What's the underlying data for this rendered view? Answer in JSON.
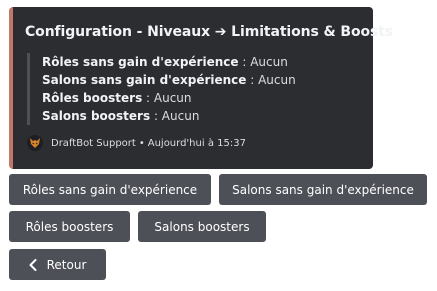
{
  "embed": {
    "accent_color": "#c27768",
    "title": "Configuration - Niveaux ➔ Limitations & Boosts",
    "fields": [
      {
        "name": "Rôles sans gain d'expérience",
        "value": " : Aucun"
      },
      {
        "name": "Salons sans gain d'expérience",
        "value": " : Aucun"
      },
      {
        "name": "Rôles boosters",
        "value": " : Aucun"
      },
      {
        "name": "Salons boosters",
        "value": " : Aucun"
      }
    ],
    "footer": {
      "avatar_icon": "draftbot-fox-icon",
      "author": "DraftBot Support",
      "separator": "•",
      "timestamp": "Aujourd'hui à 15:37"
    }
  },
  "buttons": {
    "roles_no_xp": "Rôles sans gain d'expérience",
    "channels_no_xp": "Salons sans gain d'expérience",
    "roles_boosters": "Rôles boosters",
    "channels_boosters": "Salons boosters",
    "back": "Retour",
    "back_icon": "chevron-left-icon"
  }
}
